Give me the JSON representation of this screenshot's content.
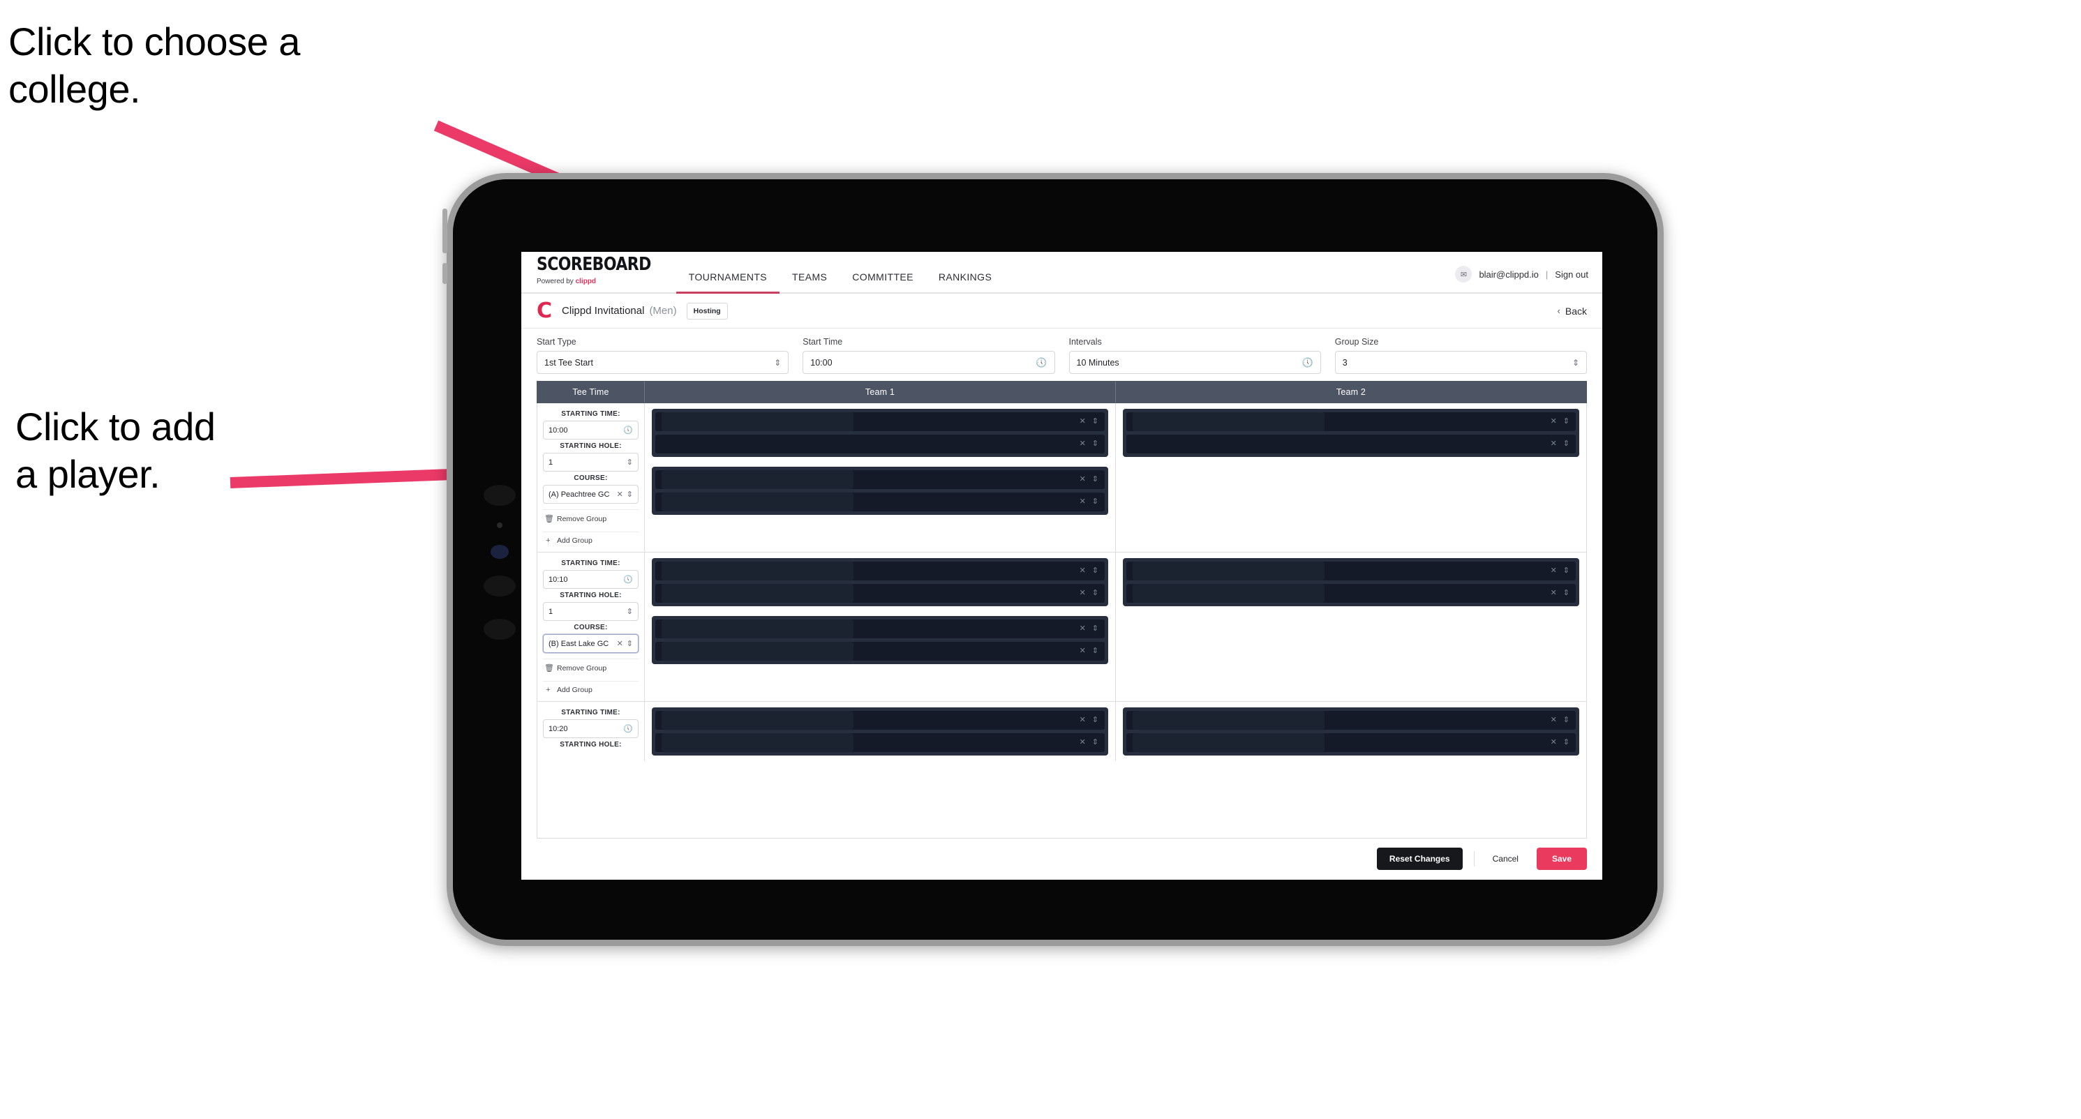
{
  "annotations": {
    "college": "Click to choose a\ncollege.",
    "player": "Click to add\na player."
  },
  "colors": {
    "accent_pink": "#ea3a5e",
    "nav_active_underline": "#c9405f",
    "table_header": "#4d5464",
    "player_row_bg": "#141a27",
    "player_group_bg": "#272e3d",
    "brand_red": "#e0274f"
  },
  "topnav": {
    "brand_word": "SCOREBOARD",
    "brand_sub_prefix": "Powered by",
    "brand_sub_name": "clippd",
    "items": [
      {
        "label": "TOURNAMENTS",
        "active": true
      },
      {
        "label": "TEAMS",
        "active": false
      },
      {
        "label": "COMMITTEE",
        "active": false
      },
      {
        "label": "RANKINGS",
        "active": false
      }
    ],
    "avatar_glyph": "✉",
    "user_email": "blair@clippd.io",
    "separator": "|",
    "sign_out": "Sign out"
  },
  "tournament_bar": {
    "logo_letter": "C",
    "title": "Clippd Invitational",
    "gender": "(Men)",
    "badge": "Hosting",
    "back_chevron": "‹",
    "back_label": "Back"
  },
  "settings": [
    {
      "label": "Start Type",
      "value": "1st Tee Start",
      "control": "select",
      "icon": "chevron-updown-icon"
    },
    {
      "label": "Start Time",
      "value": "10:00",
      "control": "time",
      "icon": "clock-icon"
    },
    {
      "label": "Intervals",
      "value": "10 Minutes",
      "control": "time",
      "icon": "clock-icon"
    },
    {
      "label": "Group Size",
      "value": "3",
      "control": "stepper",
      "icon": "chevron-updown-icon"
    }
  ],
  "table": {
    "headers": [
      "Tee Time",
      "Team 1",
      "Team 2"
    ],
    "labels": {
      "starting_time": "STARTING TIME:",
      "starting_hole": "STARTING HOLE:",
      "course": "COURSE:",
      "remove_group": "Remove Group",
      "add_group": "Add Group",
      "remove_icon": "trash-icon",
      "add_icon": "plus-icon",
      "clear_icon": "x-icon",
      "stepper_icon": "chevron-updown-icon",
      "clock_icon": "clock-icon"
    },
    "rows": [
      {
        "starting_time": "10:00",
        "starting_hole": "1",
        "course": "(A) Peachtree GC",
        "course_focused": false,
        "team1_groups": [
          {
            "players": 2
          },
          {
            "players": 2
          }
        ],
        "team2_groups": [
          {
            "players": 2
          }
        ]
      },
      {
        "starting_time": "10:10",
        "starting_hole": "1",
        "course": "(B) East Lake GC",
        "course_focused": true,
        "team1_groups": [
          {
            "players": 2
          },
          {
            "players": 2
          }
        ],
        "team2_groups": [
          {
            "players": 2
          }
        ]
      },
      {
        "starting_time": "10:20",
        "starting_hole": "",
        "course": "",
        "course_focused": false,
        "team1_groups": [
          {
            "players": 2
          }
        ],
        "team2_groups": [
          {
            "players": 2
          }
        ]
      }
    ]
  },
  "footer": {
    "reset": "Reset Changes",
    "cancel": "Cancel",
    "save": "Save"
  }
}
